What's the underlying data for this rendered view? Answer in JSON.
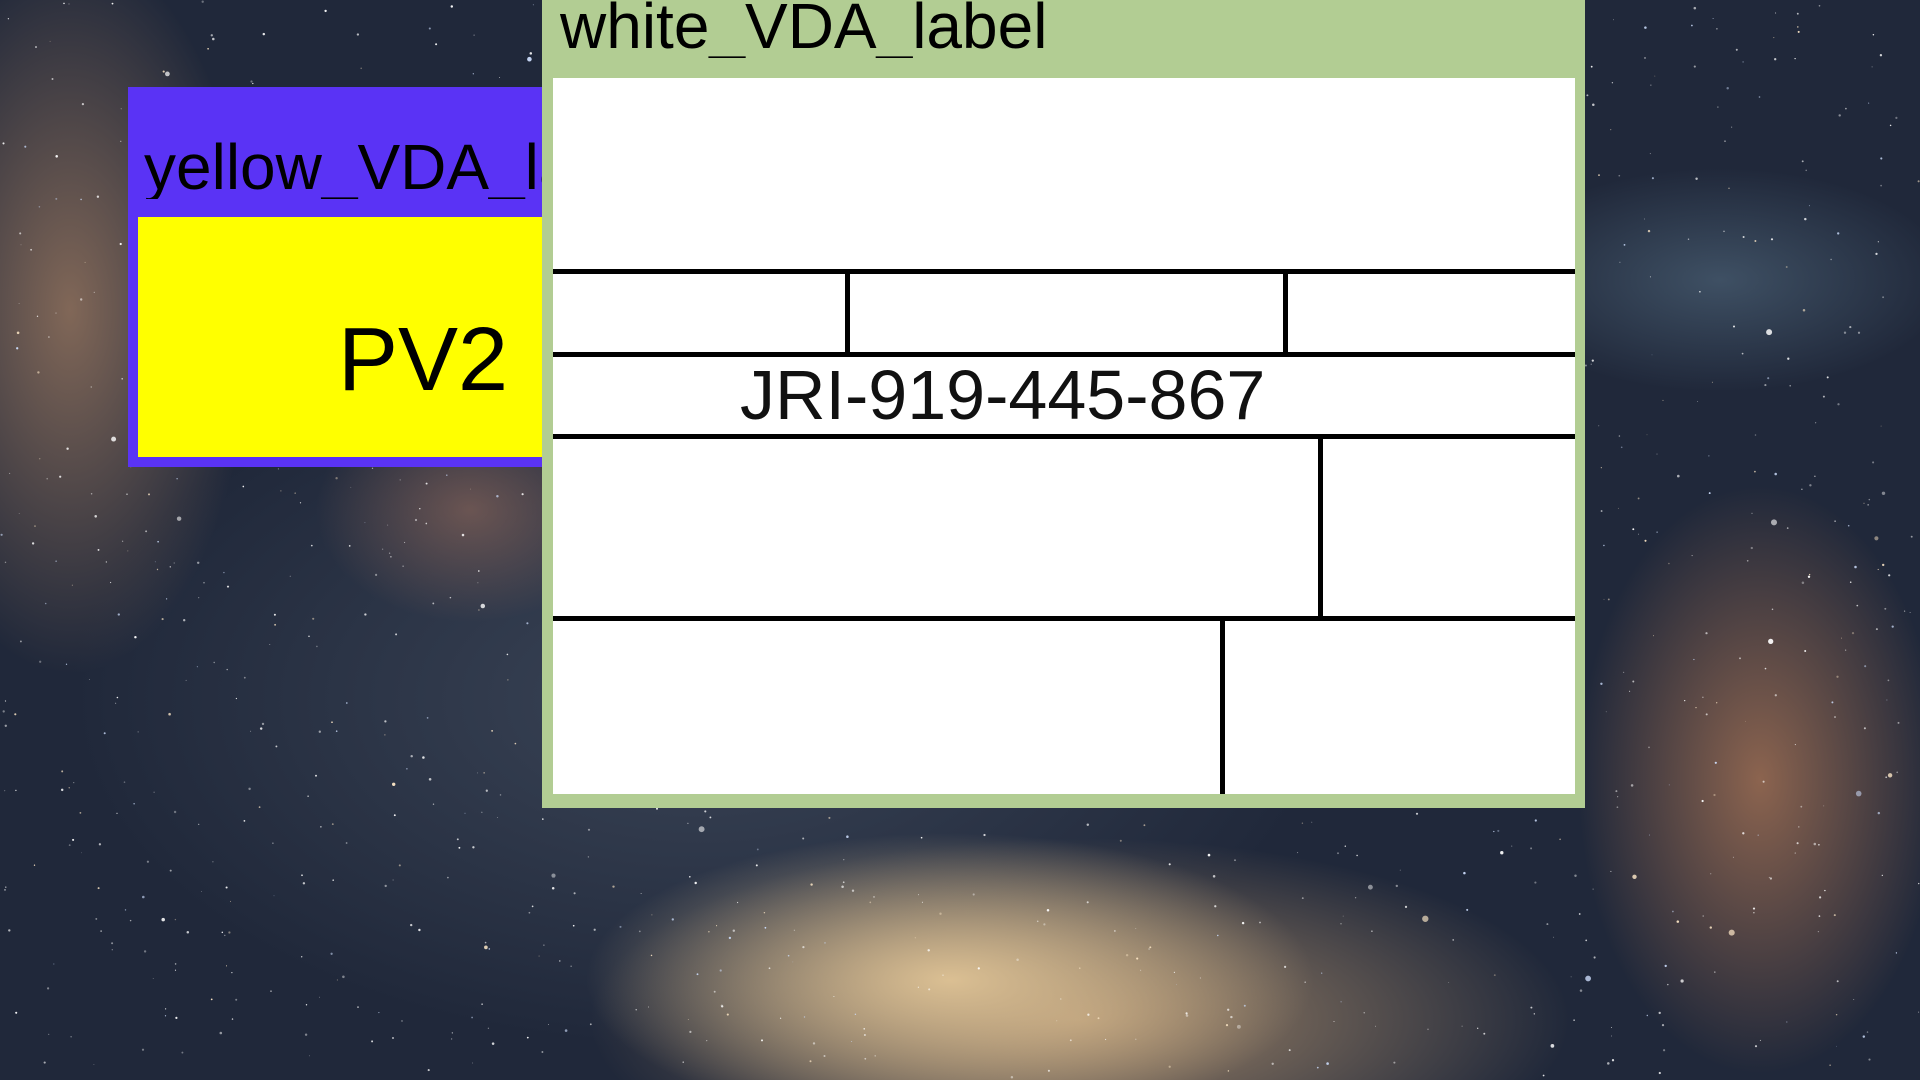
{
  "desktop": {
    "wallpaper_icon": "milky-way-wallpaper"
  },
  "yellow_window": {
    "title": "yellow_VDA_label",
    "body_text": "PV2",
    "frame_color": "#5a33f5",
    "body_color": "#ffff00"
  },
  "white_window": {
    "title": "white_VDA_label",
    "code_text": "JRI-919-445-867",
    "frame_color": "#b2cd93",
    "body_color": "#ffffff"
  }
}
